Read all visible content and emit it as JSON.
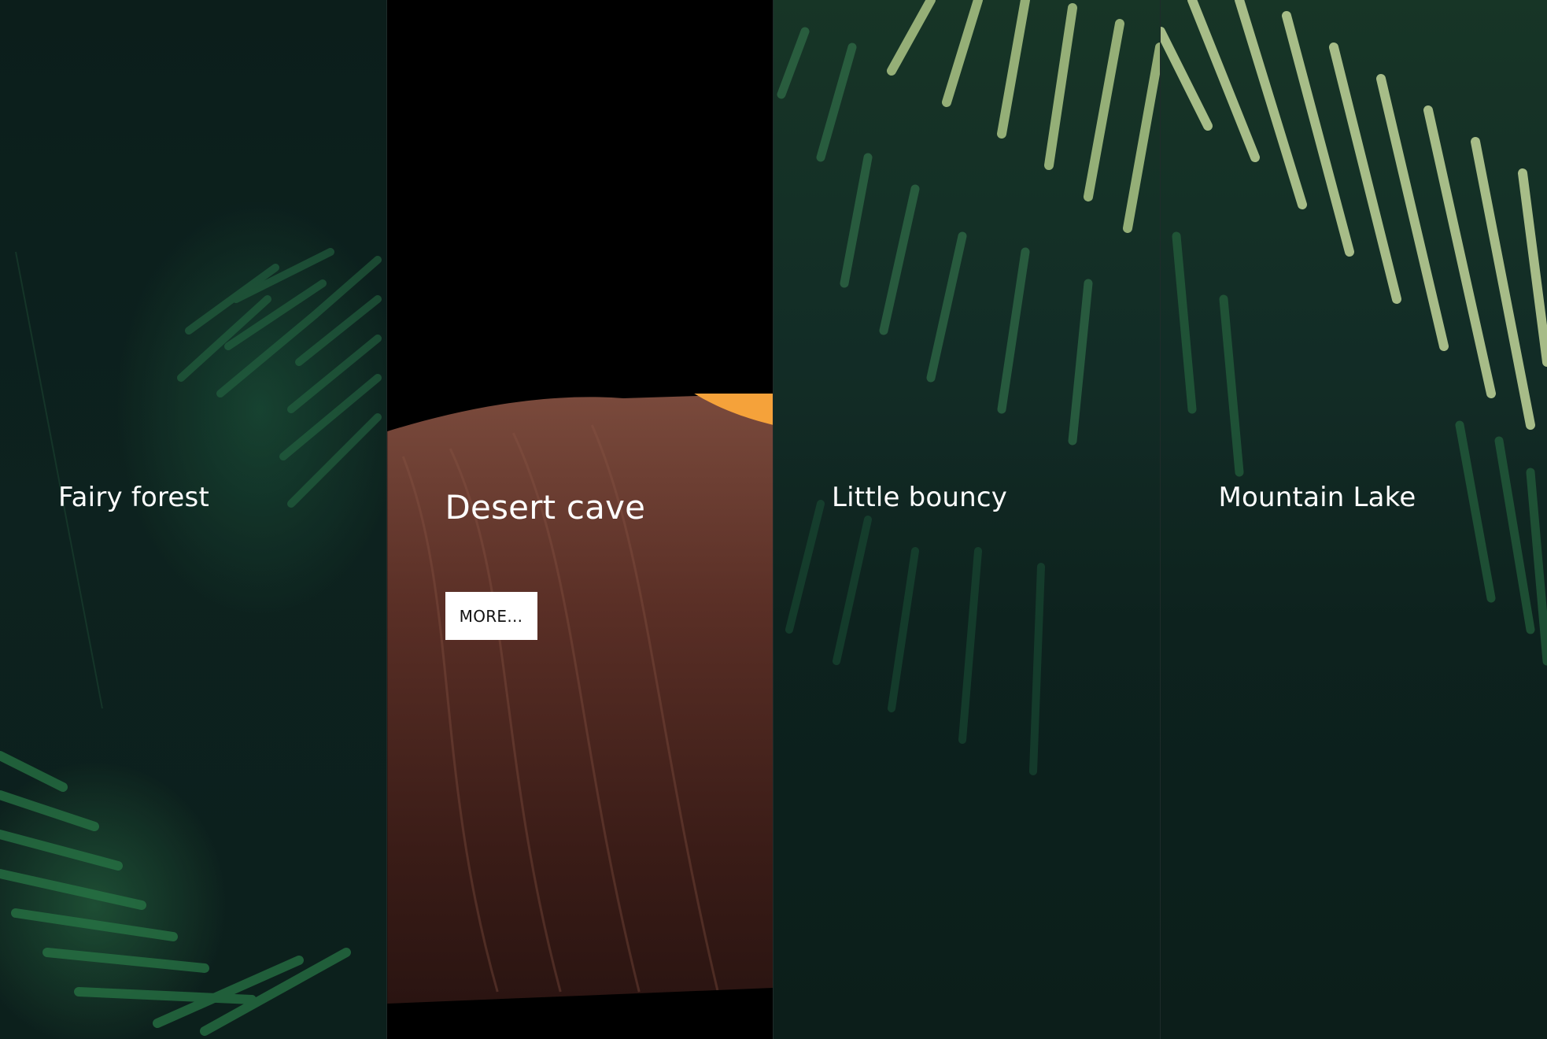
{
  "panels": [
    {
      "title": "Fairy forest"
    },
    {
      "title": "Desert cave",
      "button_label": "MORE..."
    },
    {
      "title": "Little bouncy"
    },
    {
      "title": "Mountain Lake"
    }
  ],
  "colors": {
    "forest_dark": "#0d1f1d",
    "fern_green": "#2f7a4a",
    "fern_light": "#cfe8a0",
    "cave_black": "#000000",
    "cave_rock": "#5a2f26",
    "cave_glow": "#f5a23a",
    "button_bg": "#ffffff",
    "title_text": "#ffffff"
  }
}
